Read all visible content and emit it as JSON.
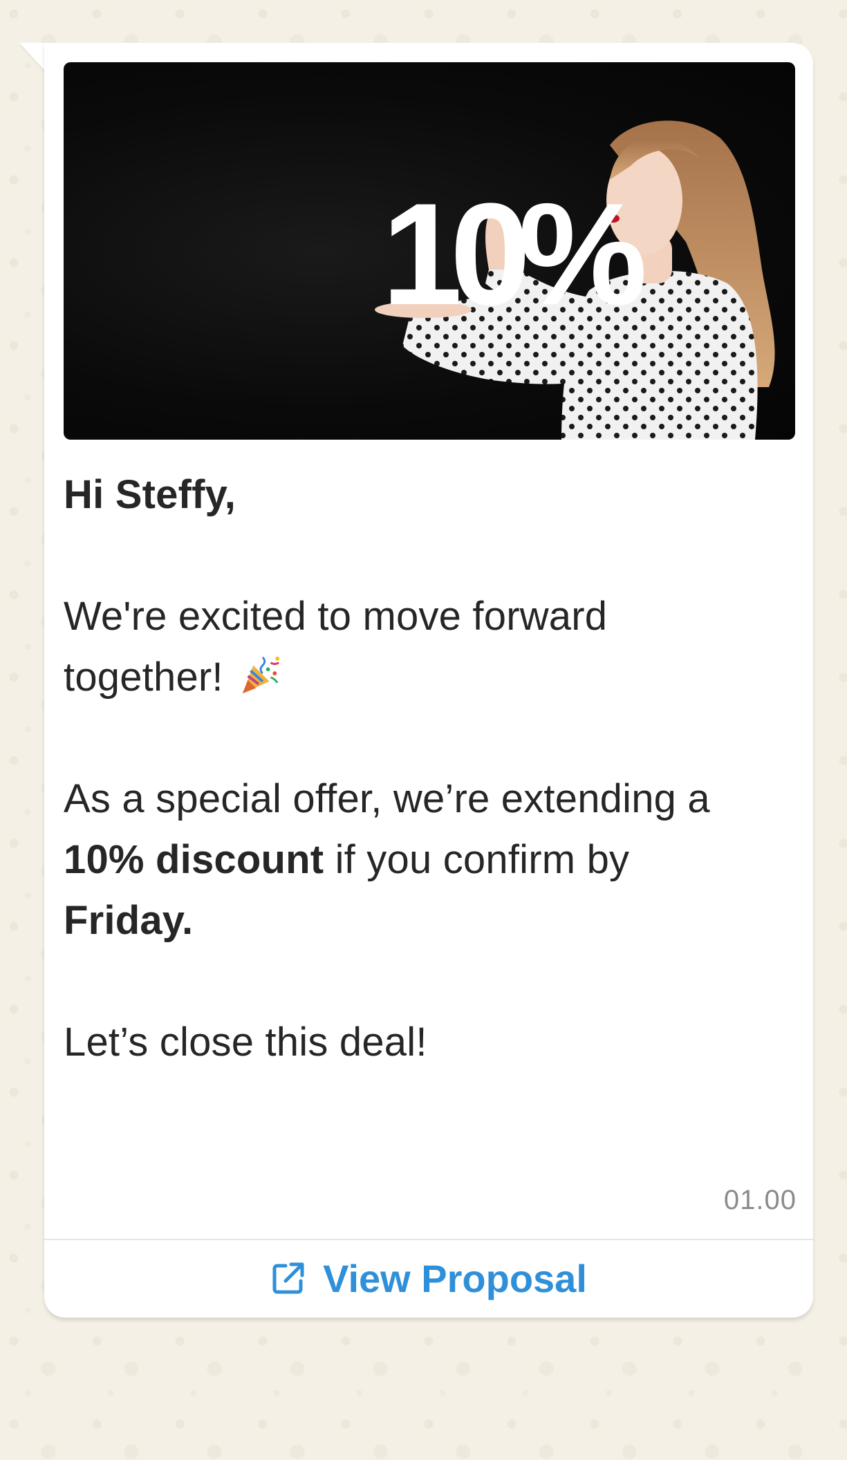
{
  "message": {
    "greeting": "Hi Steffy,",
    "paragraph1_line1": "We're excited to move forward",
    "paragraph1_line2": "together!",
    "paragraph2_part1": "As a special offer, we’re extending a",
    "paragraph2_bold1": "10% discount",
    "paragraph2_part2": " if you confirm by",
    "paragraph2_bold2": "Friday.",
    "closing": "Let’s close this deal!",
    "timestamp": "01.00"
  },
  "hero": {
    "sign_text": "10%"
  },
  "action": {
    "label": "View Proposal",
    "icon": "external-link-icon"
  },
  "colors": {
    "background": "#f5f0e5",
    "bubble": "#ffffff",
    "text": "#262626",
    "timestamp": "#8b8b8b",
    "link": "#2f8fd8"
  }
}
